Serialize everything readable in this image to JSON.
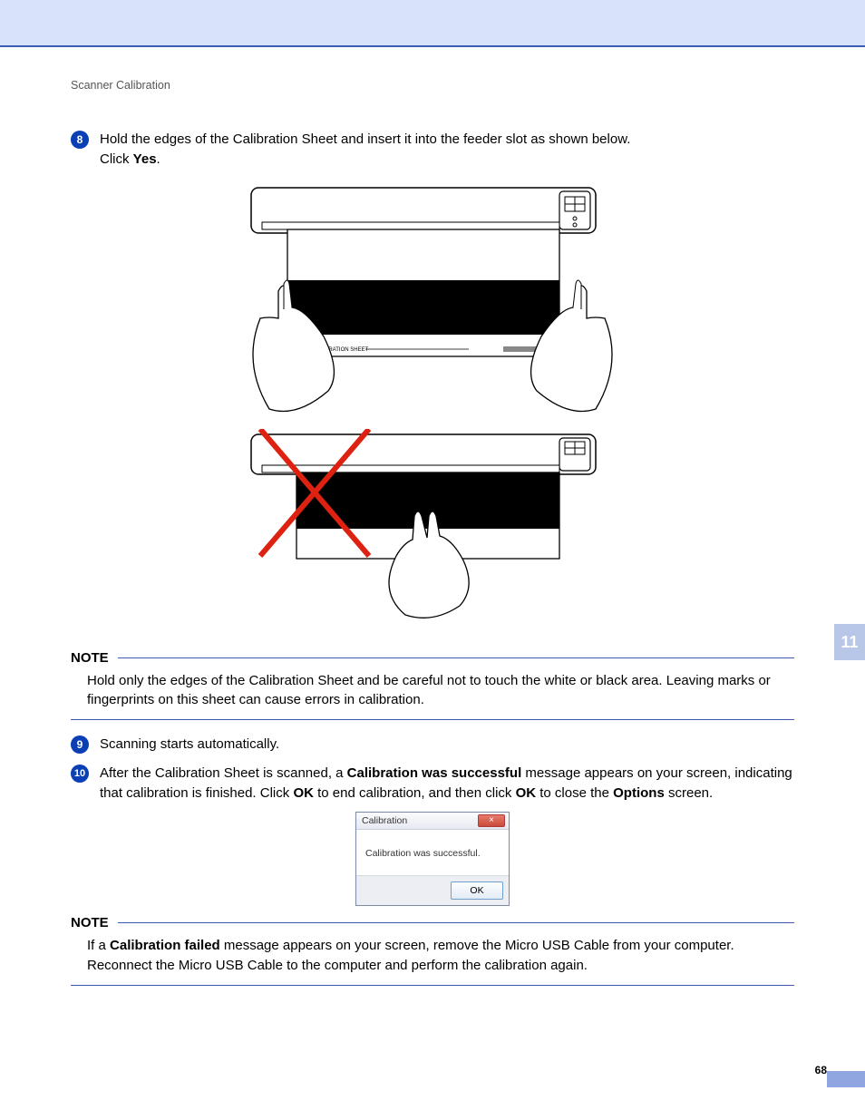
{
  "breadcrumb": "Scanner Calibration",
  "chapter_tab": "11",
  "page_number": "68",
  "steps": {
    "s8": {
      "num": "8",
      "text_a": "Hold the edges of the Calibration Sheet and insert it into the feeder slot as shown below.",
      "text_b": "Click ",
      "bold_b": "Yes",
      "text_c": "."
    },
    "s9": {
      "num": "9",
      "text": "Scanning starts automatically."
    },
    "s10": {
      "num": "10",
      "text_a": "After the Calibration Sheet is scanned, a ",
      "bold_a": "Calibration was successful",
      "text_b": " message appears on your screen, indicating that calibration is finished. Click ",
      "bold_b": "OK",
      "text_c": " to end calibration, and then click ",
      "bold_c": "OK",
      "text_d": " to close the ",
      "bold_d": "Options",
      "text_e": " screen."
    }
  },
  "figure_label": "CALIBRATION SHEET",
  "note1": {
    "label": "NOTE",
    "body": "Hold only the edges of the Calibration Sheet and be careful not to touch the white or black area. Leaving marks or fingerprints on this sheet can cause errors in calibration."
  },
  "note2": {
    "label": "NOTE",
    "body_a": "If a ",
    "bold_a": "Calibration failed",
    "body_b": " message appears on your screen, remove the Micro USB Cable from your computer. Reconnect the Micro USB Cable to the computer and perform the calibration again."
  },
  "dialog": {
    "title": "Calibration",
    "close_glyph": "×",
    "message": "Calibration was successful.",
    "ok": "OK"
  }
}
